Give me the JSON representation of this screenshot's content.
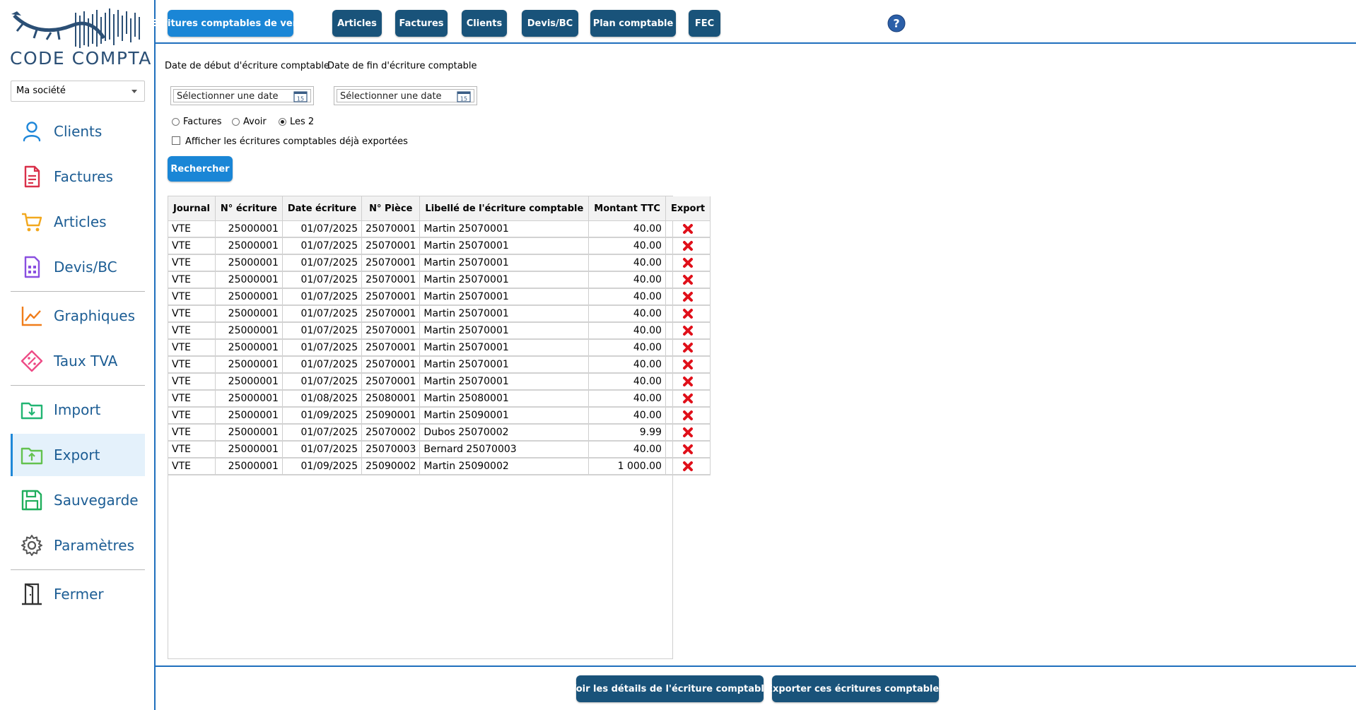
{
  "brand": {
    "name": "CODE COMPTA"
  },
  "company_select": {
    "value": "Ma société"
  },
  "nav": {
    "clients": "Clients",
    "factures": "Factures",
    "articles": "Articles",
    "devis": "Devis/BC",
    "graphiques": "Graphiques",
    "taux_tva": "Taux TVA",
    "import": "Import",
    "export": "Export",
    "sauvegarde": "Sauvegarde",
    "parametres": "Paramètres",
    "fermer": "Fermer",
    "active": "export"
  },
  "tabs": {
    "ventes": "Ecritures comptables de vente",
    "articles": "Articles",
    "factures": "Factures",
    "clients": "Clients",
    "devis": "Devis/BC",
    "plan": "Plan comptable",
    "fec": "FEC",
    "active": "ventes"
  },
  "filters": {
    "date_start_label": "Date de début d'écriture comptable",
    "date_end_label": "Date de fin d'écriture comptable",
    "date_start_placeholder": "Sélectionner une date",
    "date_end_placeholder": "Sélectionner une date",
    "calendar_day": "15",
    "radio_factures": "Factures",
    "radio_avoir": "Avoir",
    "radio_les2": "Les 2",
    "radio_selected": "Les 2",
    "checkbox_label": "Afficher les écritures comptables déjà exportées",
    "checkbox_checked": false,
    "search_button": "Rechercher"
  },
  "table": {
    "headers": [
      "Journal",
      "N° écriture",
      "Date écriture",
      "N° Pièce",
      "Libellé de l'écriture comptable",
      "Montant TTC",
      "Export"
    ],
    "rows": [
      [
        "VTE",
        "25000001",
        "01/07/2025",
        "25070001",
        "Martin 25070001",
        "40.00"
      ],
      [
        "VTE",
        "25000001",
        "01/07/2025",
        "25070001",
        "Martin 25070001",
        "40.00"
      ],
      [
        "VTE",
        "25000001",
        "01/07/2025",
        "25070001",
        "Martin 25070001",
        "40.00"
      ],
      [
        "VTE",
        "25000001",
        "01/07/2025",
        "25070001",
        "Martin 25070001",
        "40.00"
      ],
      [
        "VTE",
        "25000001",
        "01/07/2025",
        "25070001",
        "Martin 25070001",
        "40.00"
      ],
      [
        "VTE",
        "25000001",
        "01/07/2025",
        "25070001",
        "Martin 25070001",
        "40.00"
      ],
      [
        "VTE",
        "25000001",
        "01/07/2025",
        "25070001",
        "Martin 25070001",
        "40.00"
      ],
      [
        "VTE",
        "25000001",
        "01/07/2025",
        "25070001",
        "Martin 25070001",
        "40.00"
      ],
      [
        "VTE",
        "25000001",
        "01/07/2025",
        "25070001",
        "Martin 25070001",
        "40.00"
      ],
      [
        "VTE",
        "25000001",
        "01/07/2025",
        "25070001",
        "Martin 25070001",
        "40.00"
      ],
      [
        "VTE",
        "25000001",
        "01/08/2025",
        "25080001",
        "Martin 25080001",
        "40.00"
      ],
      [
        "VTE",
        "25000001",
        "01/09/2025",
        "25090001",
        "Martin 25090001",
        "40.00"
      ],
      [
        "VTE",
        "25000001",
        "01/07/2025",
        "25070002",
        "Dubos 25070002",
        "9.99"
      ],
      [
        "VTE",
        "25000001",
        "01/07/2025",
        "25070003",
        "Bernard 25070003",
        "40.00"
      ],
      [
        "VTE",
        "25000001",
        "01/09/2025",
        "25090002",
        "Martin 25090002",
        "1 000.00"
      ]
    ],
    "export_icon": "red-cross-icon"
  },
  "footer": {
    "details_button": "Voir les détails de l'écriture comptable",
    "export_button": "Exporter ces écritures comptables"
  },
  "colors": {
    "accent": "#1a86d6",
    "button_dark": "#19537a",
    "nav_text": "#1c5d94",
    "active_nav_bg": "#e4f1fb",
    "export_cross": "#e0101a"
  }
}
